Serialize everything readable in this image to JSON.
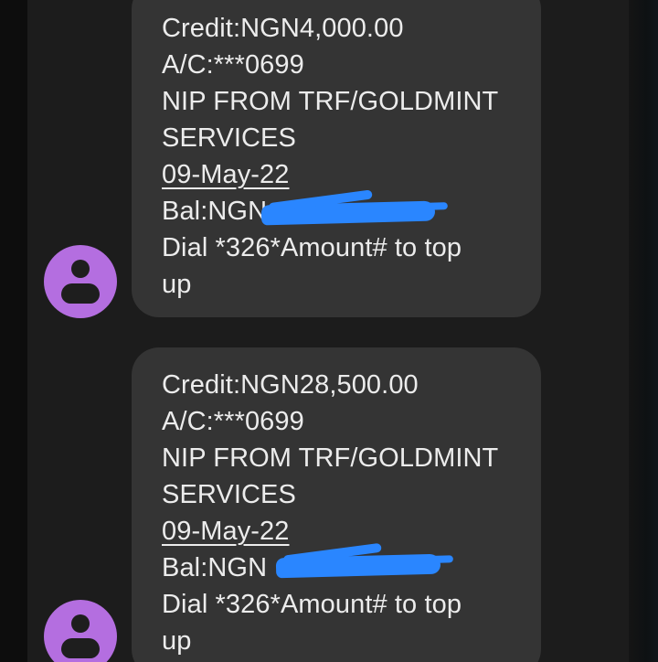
{
  "messages": [
    {
      "credit": "Credit:NGN4,000.00",
      "account": "A/C:***0699",
      "narration_1": "NIP FROM TRF/GOLDMINT",
      "narration_2": "SERVICES",
      "date": "09-May-22",
      "balance": "Bal:NGN",
      "dial_1": "Dial *326*Amount# to top",
      "dial_2": "up"
    },
    {
      "credit": "Credit:NGN28,500.00",
      "account": "A/C:***0699",
      "narration_1": "NIP FROM TRF/GOLDMINT",
      "narration_2": "SERVICES",
      "date": "09-May-22",
      "balance": "Bal:NGN",
      "dial_1": "Dial *326*Amount# to top",
      "dial_2": "up"
    }
  ],
  "colors": {
    "background": "#1c1c1c",
    "bubble": "#343434",
    "text": "#ececec",
    "avatar": "#b46ee0",
    "redaction": "#2a86ff"
  },
  "icons": {
    "avatar": "person-icon"
  }
}
